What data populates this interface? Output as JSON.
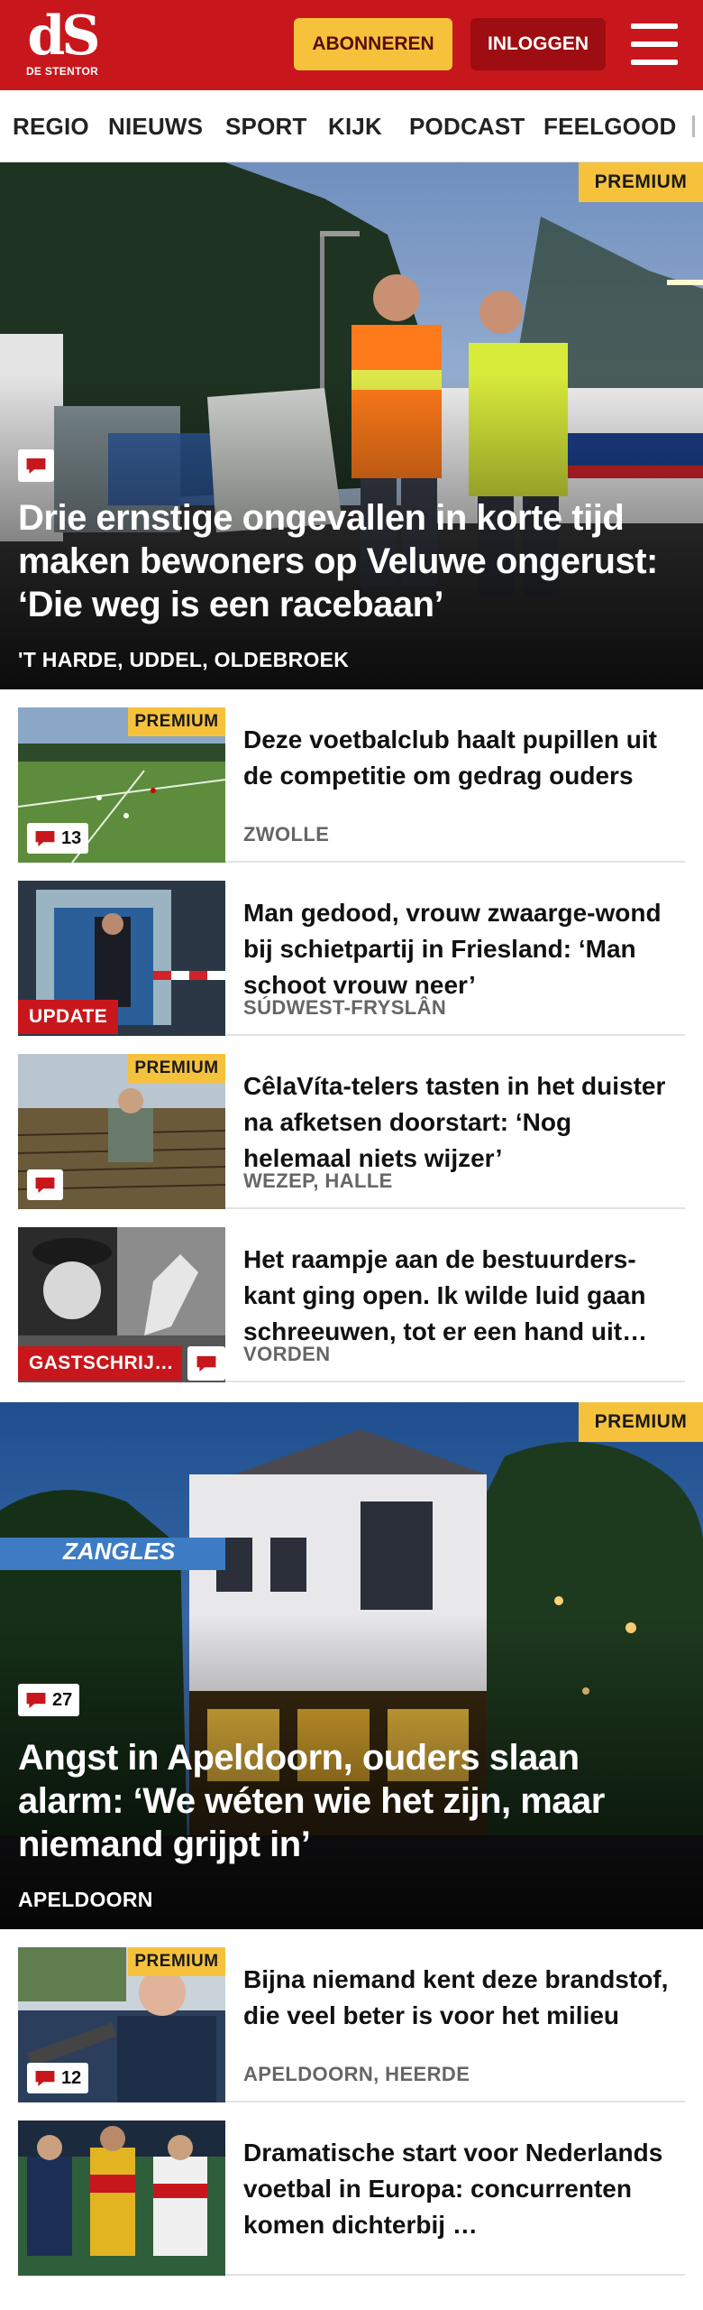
{
  "header": {
    "logo_text": "dS",
    "logo_sub": "DE STENTOR",
    "subscribe_label": "ABONNEREN",
    "login_label": "INLOGGEN",
    "brand_color": "#c8171c",
    "accent_color": "#f6c23c"
  },
  "nav": {
    "items": [
      "REGIO",
      "NIEUWS",
      "SPORT",
      "KIJK",
      "PODCAST",
      "FEELGOOD"
    ]
  },
  "hero1": {
    "premium": "PREMIUM",
    "title": "Drie ernstige ongevallen in korte tijd maken bewoners op Veluwe ongerust: ‘Die weg is een racebaan’",
    "location": "'T HARDE, UDDEL, OLDEBROEK",
    "icon": "comment-icon"
  },
  "articles1": [
    {
      "title": "Deze voetbalclub haalt pupillen uit de competitie om gedrag ouders",
      "location": "ZWOLLE",
      "premium": "PREMIUM",
      "comments": "13"
    },
    {
      "title": "Man gedood, vrouw zwaarge-wond bij schietpartij in Friesland: ‘Man schoot vrouw neer’",
      "location": "SÚDWEST-FRYSLÂN",
      "tag": "UPDATE"
    },
    {
      "title": "CêlaVíta-telers tasten in het duister na afketsen doorstart: ‘Nog helemaal niets wijzer’",
      "location": "WEZEP, HALLE",
      "premium": "PREMIUM"
    },
    {
      "title": "Het raampje aan de bestuurders-kant ging open. Ik wilde luid gaan schreeuwen, tot er een hand uit…",
      "location": "VORDEN",
      "tag": "GASTSCHRIJ…"
    }
  ],
  "hero2": {
    "premium": "PREMIUM",
    "comments": "27",
    "title": "Angst in Apeldoorn, ouders slaan alarm: ‘We wéten wie het zijn, maar niemand grijpt in’",
    "location": "APELDOORN",
    "banner_text": "ZANGLES"
  },
  "articles2": [
    {
      "title": "Bijna niemand kent deze brandstof, die veel beter is voor het milieu",
      "location": "APELDOORN, HEERDE",
      "premium": "PREMIUM",
      "comments": "12"
    },
    {
      "title": "Dramatische start voor Nederlands voetbal in Europa: concurrenten komen dichterbij …",
      "location": ""
    }
  ]
}
